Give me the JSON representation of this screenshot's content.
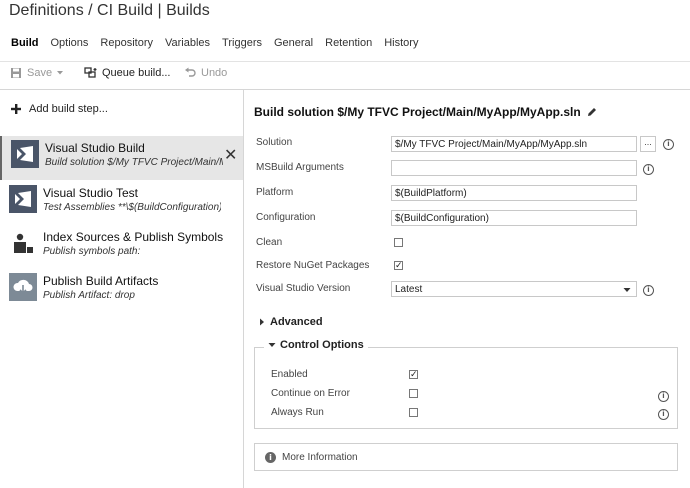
{
  "title": "Definitions / CI Build | Builds",
  "tabs": [
    "Build",
    "Options",
    "Repository",
    "Variables",
    "Triggers",
    "General",
    "Retention",
    "History"
  ],
  "toolbar": {
    "save": "Save",
    "queue": "Queue build...",
    "undo": "Undo"
  },
  "left": {
    "add_step": "Add build step...",
    "steps": [
      {
        "name": "Visual Studio Build",
        "desc": "Build solution $/My TFVC Project/Main/MyApp/MyApp.sln"
      },
      {
        "name": "Visual Studio Test",
        "desc": "Test Assemblies **\\$(BuildConfiguration)\\*test*.dll"
      },
      {
        "name": "Index Sources & Publish Symbols",
        "desc": "Publish symbols path:"
      },
      {
        "name": "Publish Build Artifacts",
        "desc": "Publish Artifact: drop"
      }
    ]
  },
  "right": {
    "title": "Build solution $/My TFVC Project/Main/MyApp/MyApp.sln",
    "fields": {
      "solution": {
        "label": "Solution",
        "value": "$/My TFVC Project/Main/MyApp/MyApp.sln"
      },
      "msbuild": {
        "label": "MSBuild Arguments",
        "value": ""
      },
      "platform": {
        "label": "Platform",
        "value": "$(BuildPlatform)"
      },
      "configuration": {
        "label": "Configuration",
        "value": "$(BuildConfiguration)"
      },
      "clean": {
        "label": "Clean",
        "checked": false
      },
      "restore": {
        "label": "Restore NuGet Packages",
        "checked": true
      },
      "vsversion": {
        "label": "Visual Studio Version",
        "value": "Latest"
      }
    },
    "browse_label": "...",
    "advanced": "Advanced",
    "control": {
      "title": "Control Options",
      "enabled": {
        "label": "Enabled",
        "checked": true
      },
      "continue": {
        "label": "Continue on Error",
        "checked": false
      },
      "always": {
        "label": "Always Run",
        "checked": false
      }
    },
    "more_info": "More Information"
  },
  "icons": {
    "add": "plus-icon",
    "close": "close-icon",
    "edit": "pencil-icon",
    "info": "info-icon",
    "save": "floppy-icon",
    "queue": "queue-build-icon",
    "undo": "undo-icon"
  },
  "colors": {
    "vs_icon": "#4a5568",
    "artifact_icon": "#7d8a96",
    "selected_bg": "#e6e6e6"
  }
}
